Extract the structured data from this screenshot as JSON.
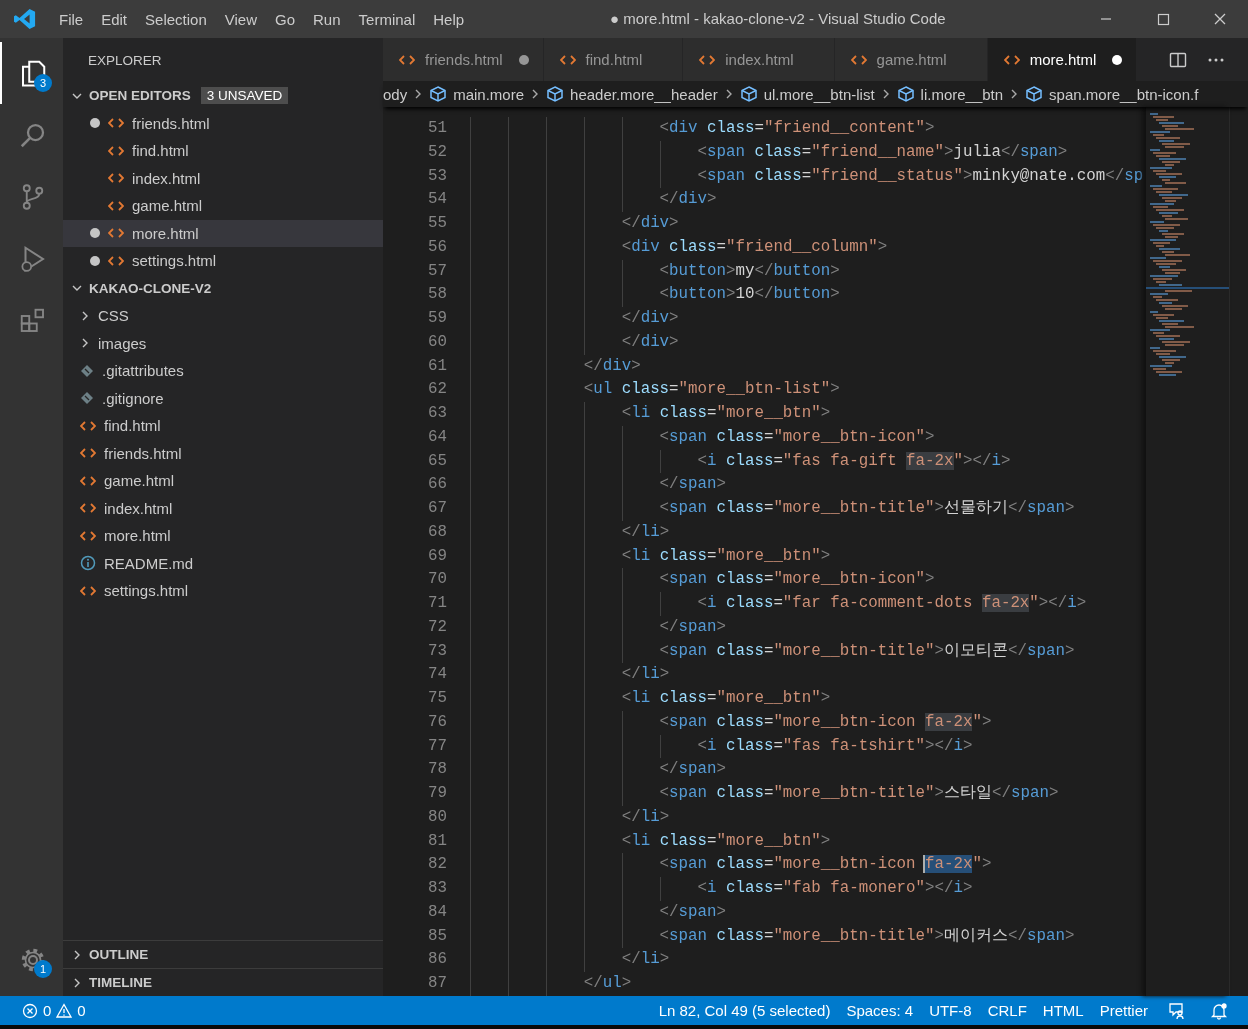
{
  "title_bar": {
    "menu": [
      "File",
      "Edit",
      "Selection",
      "View",
      "Go",
      "Run",
      "Terminal",
      "Help"
    ],
    "title": "● more.html - kakao-clone-v2 - Visual Studio Code"
  },
  "activity_bar": {
    "items": [
      {
        "kind": "explorer",
        "selected": true,
        "badge": "3"
      },
      {
        "kind": "search",
        "selected": false
      },
      {
        "kind": "source-control",
        "selected": false
      },
      {
        "kind": "run",
        "selected": false
      },
      {
        "kind": "extensions",
        "selected": false
      }
    ],
    "manage": {
      "badge": "1"
    }
  },
  "sidebar": {
    "title": "EXPLORER",
    "sections": [
      {
        "kind": "open-editors",
        "title": "OPEN EDITORS",
        "badge": "3 UNSAVED",
        "expanded": true,
        "items": [
          {
            "name": "friends.html",
            "kind": "html",
            "dirty": true,
            "selected": false
          },
          {
            "name": "find.html",
            "kind": "html",
            "dirty": false,
            "selected": false
          },
          {
            "name": "index.html",
            "kind": "html",
            "dirty": false,
            "selected": false
          },
          {
            "name": "game.html",
            "kind": "html",
            "dirty": false,
            "selected": false
          },
          {
            "name": "more.html",
            "kind": "html",
            "dirty": true,
            "selected": true
          },
          {
            "name": "settings.html",
            "kind": "html",
            "dirty": true,
            "selected": false
          }
        ]
      },
      {
        "kind": "folder",
        "title": "KAKAO-CLONE-V2",
        "expanded": true,
        "children": [
          {
            "name": "CSS",
            "kind": "folder",
            "expanded": false
          },
          {
            "name": "images",
            "kind": "folder",
            "expanded": false
          },
          {
            "name": ".gitattributes",
            "kind": "git"
          },
          {
            "name": ".gitignore",
            "kind": "git"
          },
          {
            "name": "find.html",
            "kind": "html"
          },
          {
            "name": "friends.html",
            "kind": "html"
          },
          {
            "name": "game.html",
            "kind": "html"
          },
          {
            "name": "index.html",
            "kind": "html"
          },
          {
            "name": "more.html",
            "kind": "html"
          },
          {
            "name": "README.md",
            "kind": "info"
          },
          {
            "name": "settings.html",
            "kind": "html"
          }
        ]
      },
      {
        "kind": "panel",
        "title": "OUTLINE",
        "expanded": false
      },
      {
        "kind": "panel",
        "title": "TIMELINE",
        "expanded": false
      }
    ]
  },
  "editor": {
    "tabs": [
      {
        "label": "friends.html",
        "selected": false,
        "dirty": true
      },
      {
        "label": "find.html",
        "selected": false,
        "dirty": false
      },
      {
        "label": "index.html",
        "selected": false,
        "dirty": false
      },
      {
        "label": "game.html",
        "selected": false,
        "dirty": false
      },
      {
        "label": "more.html",
        "selected": true,
        "dirty": true
      }
    ],
    "breadcrumbs": [
      {
        "label": "ody",
        "kind": "file"
      },
      {
        "label": "main.more",
        "kind": "element"
      },
      {
        "label": "header.more__header",
        "kind": "element"
      },
      {
        "label": "ul.more__btn-list",
        "kind": "element"
      },
      {
        "label": "li.more__btn",
        "kind": "element"
      },
      {
        "label": "span.more__btn-icon.f",
        "kind": "element"
      }
    ],
    "lines": [
      {
        "number": "51",
        "text": "                    <div class=\"friend__content\">"
      },
      {
        "number": "52",
        "text": "                        <span class=\"friend__name\">julia</span>"
      },
      {
        "number": "53",
        "text": "                        <span class=\"friend__status\">minky@nate.com</sp"
      },
      {
        "number": "54",
        "text": "                    </div>"
      },
      {
        "number": "55",
        "text": "                </div>"
      },
      {
        "number": "56",
        "text": "                <div class=\"friend__column\">"
      },
      {
        "number": "57",
        "text": "                    <button>my</button>"
      },
      {
        "number": "58",
        "text": "                    <button>10</button>"
      },
      {
        "number": "59",
        "text": "                </div>"
      },
      {
        "number": "60",
        "text": "                </div>"
      },
      {
        "number": "61",
        "text": "            </div>"
      },
      {
        "number": "62",
        "text": "            <ul class=\"more__btn-list\">"
      },
      {
        "number": "63",
        "text": "                <li class=\"more__btn\">"
      },
      {
        "number": "64",
        "text": "                    <span class=\"more__btn-icon\">"
      },
      {
        "number": "65",
        "segments": [
          {
            "text": "                        <i class=\"fas fa-gift ",
            "highlighted": false,
            "selected": false
          },
          {
            "text": "fa-2x",
            "highlighted": true,
            "selected": false
          },
          {
            "text": "\"></i>",
            "highlighted": false,
            "selected": false
          }
        ]
      },
      {
        "number": "66",
        "text": "                    </span>"
      },
      {
        "number": "67",
        "text": "                    <span class=\"more__btn-title\">선물하기</span>"
      },
      {
        "number": "68",
        "text": "                </li>"
      },
      {
        "number": "69",
        "text": "                <li class=\"more__btn\">"
      },
      {
        "number": "70",
        "text": "                    <span class=\"more__btn-icon\">"
      },
      {
        "number": "71",
        "segments": [
          {
            "text": "                        <i class=\"far fa-comment-dots ",
            "highlighted": false,
            "selected": false
          },
          {
            "text": "fa-2x",
            "highlighted": true,
            "selected": false
          },
          {
            "text": "\"></i>",
            "highlighted": false,
            "selected": false
          }
        ]
      },
      {
        "number": "72",
        "text": "                    </span>"
      },
      {
        "number": "73",
        "text": "                    <span class=\"more__btn-title\">이모티콘</span>"
      },
      {
        "number": "74",
        "text": "                </li>"
      },
      {
        "number": "75",
        "text": "                <li class=\"more__btn\">"
      },
      {
        "number": "76",
        "segments": [
          {
            "text": "                    <span class=\"more__btn-icon ",
            "highlighted": false,
            "selected": false
          },
          {
            "text": "fa-2x",
            "highlighted": true,
            "selected": false
          },
          {
            "text": "\">",
            "highlighted": false,
            "selected": false
          }
        ]
      },
      {
        "number": "77",
        "text": "                        <i class=\"fas fa-tshirt\"></i>"
      },
      {
        "number": "78",
        "text": "                    </span>"
      },
      {
        "number": "79",
        "text": "                    <span class=\"more__btn-title\">스타일</span>"
      },
      {
        "number": "80",
        "text": "                </li>"
      },
      {
        "number": "81",
        "text": "                <li class=\"more__btn\">"
      },
      {
        "number": "82",
        "segments": [
          {
            "text": "                    <span class=\"more__btn-icon ",
            "highlighted": false,
            "selected": false
          },
          {
            "text": "fa-2x",
            "highlighted": false,
            "selected": true
          },
          {
            "text": "\">",
            "highlighted": false,
            "selected": false
          }
        ]
      },
      {
        "number": "83",
        "text": "                        <i class=\"fab fa-monero\"></i>"
      },
      {
        "number": "84",
        "text": "                    </span>"
      },
      {
        "number": "85",
        "text": "                    <span class=\"more__btn-title\">메이커스</span>"
      },
      {
        "number": "86",
        "text": "                </li>"
      },
      {
        "number": "87",
        "text": "            </ul>"
      }
    ]
  },
  "status_bar": {
    "errors": "0",
    "warnings": "0",
    "items": [
      "Ln 82, Col 49 (5 selected)",
      "Spaces: 4",
      "UTF-8",
      "CRLF",
      "HTML",
      "Prettier"
    ]
  }
}
